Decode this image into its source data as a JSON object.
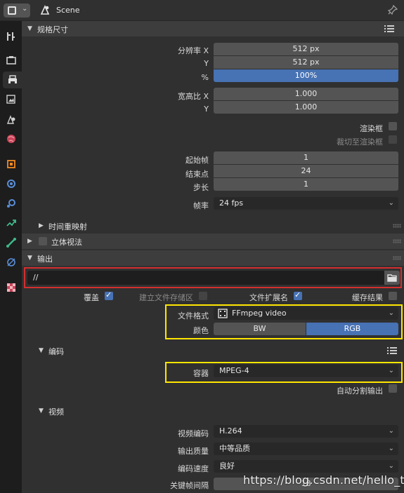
{
  "header": {
    "scene_title": "Scene"
  },
  "dimensions": {
    "title": "规格尺寸",
    "res_x_label": "分辨率 X",
    "res_x": "512 px",
    "res_y_label": "Y",
    "res_y": "512 px",
    "pct_label": "%",
    "pct": "100%",
    "aspect_x_label": "宽高比 X",
    "aspect_x": "1.000",
    "aspect_y_label": "Y",
    "aspect_y": "1.000",
    "render_region_label": "渲染框",
    "crop_label": "裁切至渲染框",
    "start_label": "起始帧",
    "start": "1",
    "end_label": "结束点",
    "end": "24",
    "step_label": "步长",
    "step": "1",
    "fps_label": "帧率",
    "fps": "24 fps",
    "time_remap_label": "时间重映射"
  },
  "stereoscopy": {
    "title": "立体视法"
  },
  "output": {
    "title": "输出",
    "path": "//",
    "overwrite_label": "覆盖",
    "placeholders_label": "建立文件存储区",
    "file_ext_label": "文件扩展名",
    "cache_label": "缓存结果",
    "file_format_label": "文件格式",
    "file_format": "FFmpeg video",
    "color_label": "颜色",
    "color_bw": "BW",
    "color_rgb": "RGB"
  },
  "encoding": {
    "title": "编码",
    "container_label": "容器",
    "container": "MPEG-4",
    "autosplit_label": "自动分割输出"
  },
  "video": {
    "title": "视频",
    "codec_label": "视频编码",
    "codec": "H.264",
    "quality_label": "输出质量",
    "quality": "中等品质",
    "speed_label": "编码速度",
    "speed": "良好",
    "keyframe_label": "关键帧间隔",
    "keyframe": "18"
  },
  "watermark": "https://blog.csdn.net/hello_tute",
  "colors": {
    "accent": "#4772b3",
    "red_highlight": "#d32f2f",
    "yellow_highlight": "#ffe600"
  }
}
